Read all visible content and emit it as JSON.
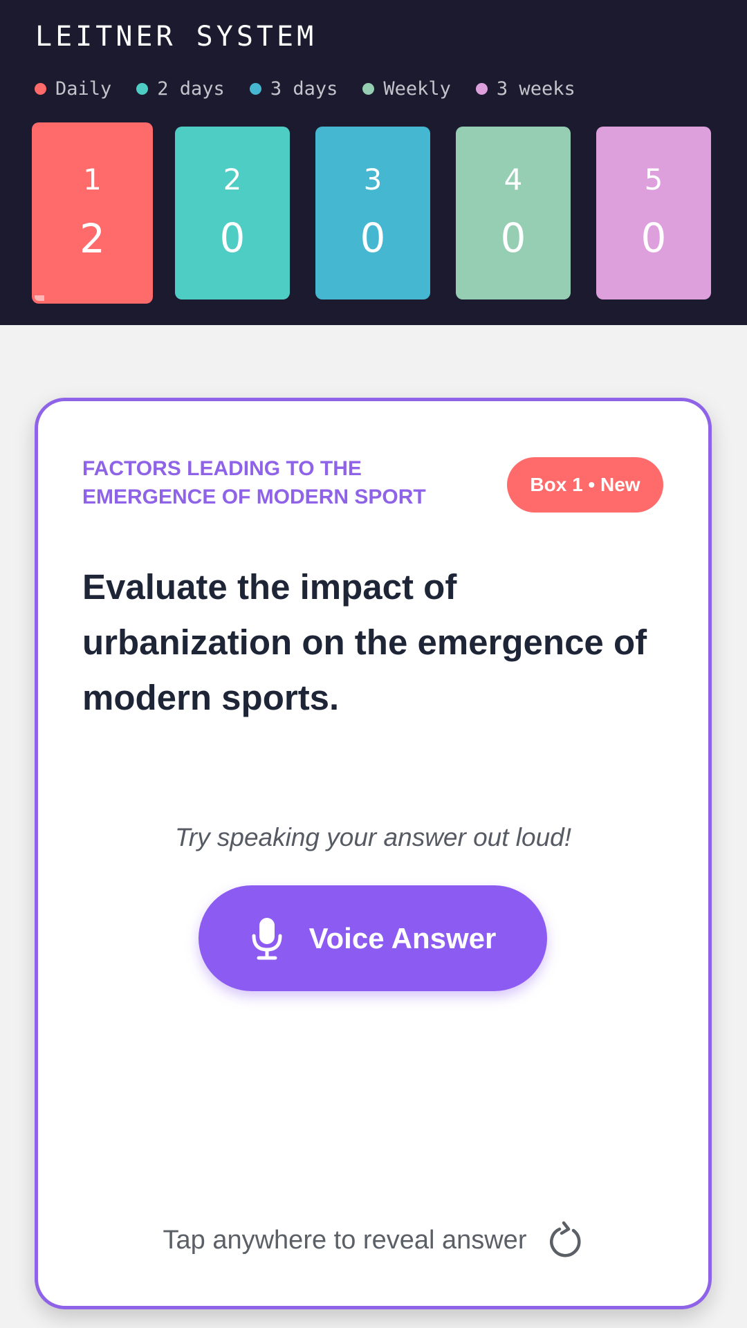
{
  "header": {
    "title": "LEITNER SYSTEM",
    "legend": [
      {
        "label": "Daily",
        "color": "#ff6b6b"
      },
      {
        "label": "2 days",
        "color": "#4ecdc4"
      },
      {
        "label": "3 days",
        "color": "#45b7d1"
      },
      {
        "label": "Weekly",
        "color": "#96ceb4"
      },
      {
        "label": "3 weeks",
        "color": "#dda0dd"
      }
    ],
    "boxes": [
      {
        "number": "1",
        "count": "2",
        "color": "#ff6b6b",
        "active": true
      },
      {
        "number": "2",
        "count": "0",
        "color": "#4ecdc4",
        "active": false
      },
      {
        "number": "3",
        "count": "0",
        "color": "#45b7d1",
        "active": false
      },
      {
        "number": "4",
        "count": "0",
        "color": "#96ceb4",
        "active": false
      },
      {
        "number": "5",
        "count": "0",
        "color": "#dda0dd",
        "active": false
      }
    ]
  },
  "card": {
    "topic": "FACTORS LEADING TO THE EMERGENCE OF MODERN SPORT",
    "badge": "Box 1 • New",
    "question": "Evaluate the impact of urbanization on the emergence of modern sports.",
    "voice_hint": "Try speaking your answer out loud!",
    "voice_button_label": "Voice Answer",
    "reveal_hint": "Tap anywhere to reveal answer",
    "accent_color": "#8e63e8",
    "badge_color": "#ff6b6b"
  },
  "icons": {
    "voice_button": "microphone-icon",
    "reveal": "refresh-icon"
  }
}
